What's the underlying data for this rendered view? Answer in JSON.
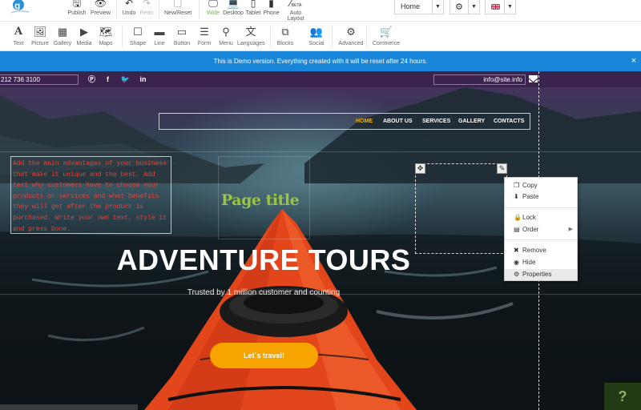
{
  "toolbar_top": {
    "buttons": [
      {
        "label": "Publish",
        "icon": "save-icon"
      },
      {
        "label": "Preview",
        "icon": "eye-icon"
      },
      {
        "label": "Undo",
        "icon": "undo-icon"
      },
      {
        "label": "Redo",
        "icon": "redo-icon"
      },
      {
        "label": "New/Reset",
        "icon": "new-file-icon"
      },
      {
        "label": "Wide",
        "icon": "monitor-icon"
      },
      {
        "label": "Desktop",
        "icon": "laptop-icon"
      },
      {
        "label": "Tablet",
        "icon": "tablet-icon"
      },
      {
        "label": "Phone",
        "icon": "phone-icon"
      },
      {
        "label": "Auto Layout",
        "icon": "magic-wand-icon",
        "badge": "BETA"
      }
    ],
    "page_select": "Home",
    "settings_icon": "gear-icon",
    "language_icon": "uk-flag-icon"
  },
  "toolbar_widgets": [
    {
      "label": "Text",
      "icon": "text-icon"
    },
    {
      "label": "Picture",
      "icon": "picture-icon"
    },
    {
      "label": "Gallery",
      "icon": "gallery-icon"
    },
    {
      "label": "Media",
      "icon": "video-icon"
    },
    {
      "label": "Maps",
      "icon": "map-icon"
    },
    {
      "label": "Shape",
      "icon": "square-icon"
    },
    {
      "label": "Line",
      "icon": "line-icon"
    },
    {
      "label": "Button",
      "icon": "button-icon"
    },
    {
      "label": "Form",
      "icon": "form-icon"
    },
    {
      "label": "Menu",
      "icon": "sitemap-icon"
    },
    {
      "label": "Languages",
      "icon": "translate-icon"
    },
    {
      "label": "Blocks",
      "icon": "blocks-icon"
    },
    {
      "label": "Social",
      "icon": "users-icon"
    },
    {
      "label": "Advanced",
      "icon": "gears-icon"
    },
    {
      "label": "Commerce",
      "icon": "cart-icon"
    }
  ],
  "banner": {
    "text": "This is Demo version. Everything created with it will be reset after 24 hours.",
    "close": "×"
  },
  "site": {
    "phone": "212 736 3100",
    "social_icons": [
      "pinterest-icon",
      "facebook-icon",
      "twitter-icon",
      "linkedin-icon"
    ],
    "email": "info@site.info",
    "nav": [
      "HOME",
      "ABOUT US",
      "SERVICES",
      "GALLERY",
      "CONTACTS"
    ],
    "text_block": "Add the main advantages of your business that make it unique and the best. Add text why customers have to choose your products or services and what benefits they will get after the product is purchased. Write your own text, style it and press Done.",
    "page_title": "Page title",
    "hero_title": "ADVENTURE TOURS",
    "hero_subtitle": "Trusted by 1 million customer and counting",
    "cta": "Let`s travel!",
    "help": "?"
  },
  "context_menu": {
    "items": [
      "Copy",
      "Paste",
      "Lock",
      "Order",
      "Remove",
      "Hide",
      "Properties"
    ],
    "highlighted": "Properties"
  },
  "colors": {
    "banner": "#1a86d9",
    "nav_active": "#f7b500",
    "cta": "#f7a400",
    "page_title": "#9bc53d",
    "text_block": "#e8423b",
    "active_device": "#7cb342"
  }
}
